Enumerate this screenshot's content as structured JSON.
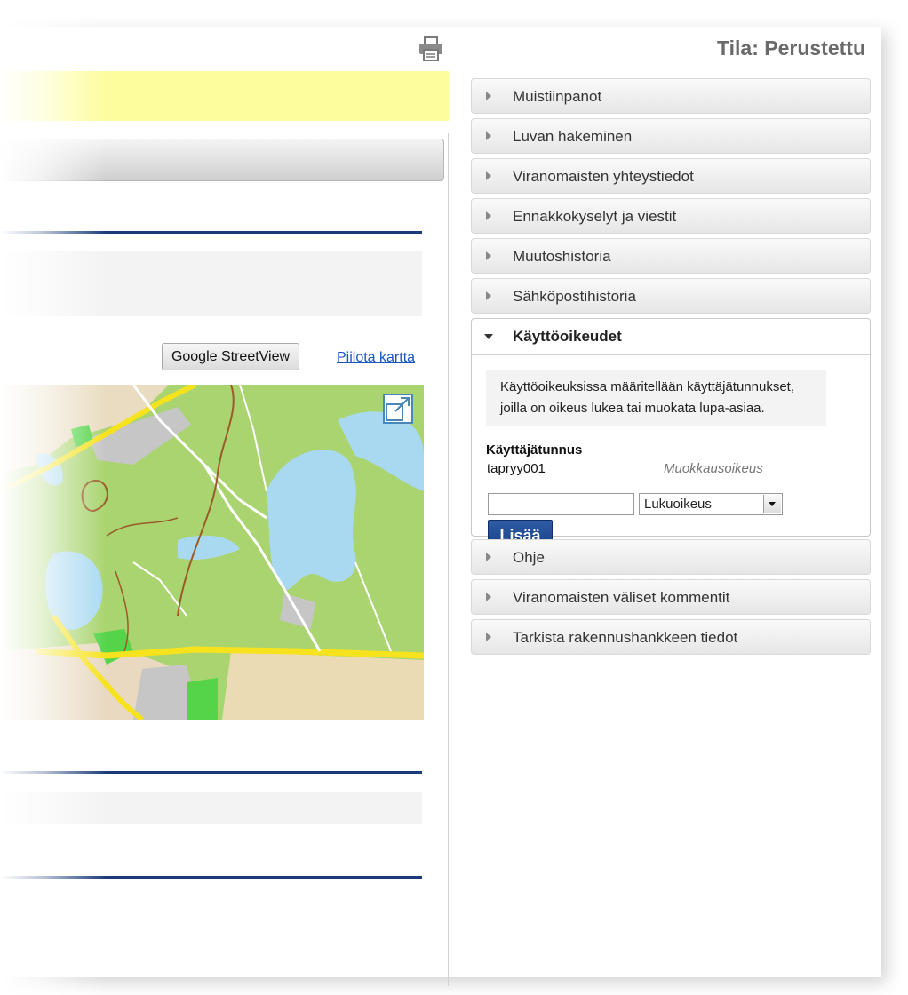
{
  "header": {
    "status": "Tila: Perustettu",
    "print_icon": "printer-icon"
  },
  "map_controls": {
    "streetview_label": "Google StreetView",
    "hide_map_label": "Piilota kartta",
    "expand_icon": "expand-icon"
  },
  "accordion": {
    "items_before": [
      {
        "label": "Muistiinpanot"
      },
      {
        "label": "Luvan hakeminen"
      },
      {
        "label": "Viranomaisten yhteystiedot"
      },
      {
        "label": "Ennakkokyselyt ja viestit"
      },
      {
        "label": "Muutoshistoria"
      },
      {
        "label": "Sähköpostihistoria"
      }
    ],
    "open_section": {
      "label": "Käyttöoikeudet",
      "info_line1": "Käyttöoikeuksissa määritellään käyttäjätunnukset,",
      "info_line2": "joilla on oikeus lukea tai muokata lupa-asiaa.",
      "user_header": "Käyttäjätunnus",
      "users": [
        {
          "username": "tapryy001",
          "right": "Muokkausoikeus"
        }
      ],
      "new_user_input_value": "",
      "right_select_value": "Lukuoikeus",
      "add_button_label": "Lisää"
    },
    "items_after": [
      {
        "label": "Ohje"
      },
      {
        "label": "Viranomaisten väliset kommentit"
      },
      {
        "label": "Tarkista rakennushankkeen tiedot"
      }
    ]
  },
  "colors": {
    "accent_blue": "#1a3b7a",
    "highlight_yellow": "#fdfd9e",
    "link_blue": "#1a55c8"
  }
}
